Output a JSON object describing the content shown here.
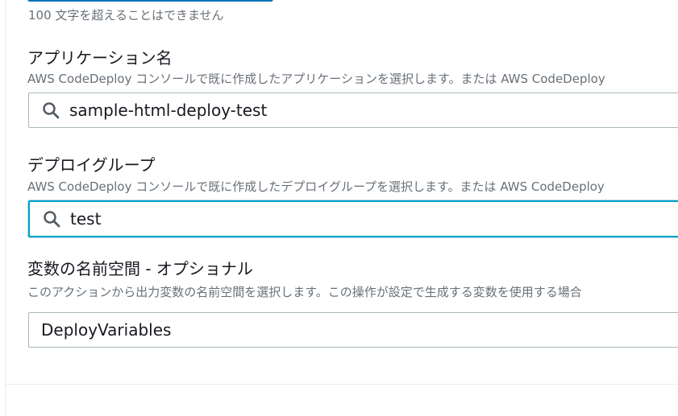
{
  "constraint_text": "100 文字を超えることはできません",
  "application": {
    "label": "アプリケーション名",
    "description": "AWS CodeDeploy コンソールで既に作成したアプリケーションを選択します。または AWS CodeDeploy",
    "value": "sample-html-deploy-test",
    "icon": "search-icon"
  },
  "deployment_group": {
    "label": "デプロイグループ",
    "description": "AWS CodeDeploy コンソールで既に作成したデプロイグループを選択します。または AWS CodeDeploy",
    "value": "test",
    "icon": "search-icon"
  },
  "variable_namespace": {
    "label": "変数の名前空間 - オプショナル",
    "description": "このアクションから出力変数の名前空間を選択します。この操作が設定で生成する変数を使用する場合",
    "value": "DeployVariables"
  },
  "colors": {
    "focus_border": "#00a1c9",
    "input_border": "#aab7b8",
    "description_text": "#687078",
    "label_text": "#16191f"
  }
}
